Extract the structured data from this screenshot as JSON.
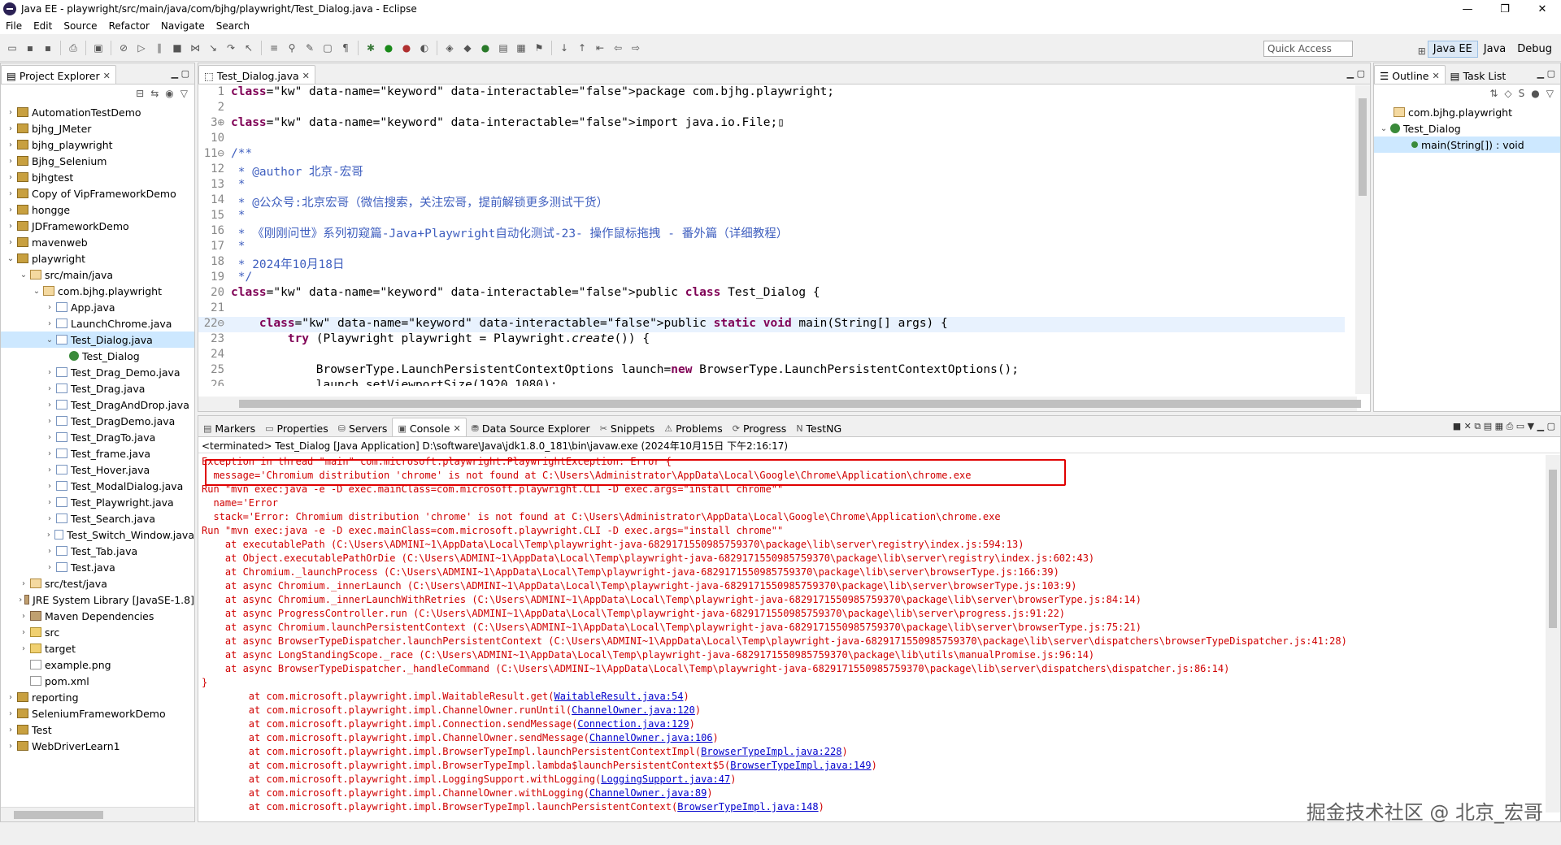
{
  "window": {
    "title": "Java EE - playwright/src/main/java/com/bjhg/playwright/Test_Dialog.java - Eclipse",
    "minimize": "—",
    "maximize": "❐",
    "close": "✕"
  },
  "menu": [
    "File",
    "Edit",
    "Source",
    "Refactor",
    "Navigate",
    "Search"
  ],
  "quick_access": {
    "placeholder": "Quick Access"
  },
  "perspectives": [
    "Java EE",
    "Java",
    "Debug"
  ],
  "project_explorer": {
    "tab": "Project Explorer",
    "items": [
      {
        "label": "AutomationTestDemo",
        "depth": 0,
        "icon": "project-icon"
      },
      {
        "label": "bjhg_JMeter",
        "depth": 0,
        "icon": "project-icon"
      },
      {
        "label": "bjhg_playwright",
        "depth": 0,
        "icon": "project-icon"
      },
      {
        "label": "Bjhg_Selenium",
        "depth": 0,
        "icon": "project-icon"
      },
      {
        "label": "bjhgtest",
        "depth": 0,
        "icon": "project-icon"
      },
      {
        "label": "Copy of VipFrameworkDemo",
        "depth": 0,
        "icon": "project-icon"
      },
      {
        "label": "hongge",
        "depth": 0,
        "icon": "project-icon"
      },
      {
        "label": "JDFrameworkDemo",
        "depth": 0,
        "icon": "project-icon"
      },
      {
        "label": "mavenweb",
        "depth": 0,
        "icon": "project-icon"
      },
      {
        "label": "playwright",
        "depth": 0,
        "icon": "project-icon"
      },
      {
        "label": "src/main/java",
        "depth": 1,
        "icon": "package-folder-icon"
      },
      {
        "label": "com.bjhg.playwright",
        "depth": 2,
        "icon": "package-icon"
      },
      {
        "label": "App.java",
        "depth": 3,
        "icon": "java-file-icon"
      },
      {
        "label": "LaunchChrome.java",
        "depth": 3,
        "icon": "java-file-icon"
      },
      {
        "label": "Test_Dialog.java",
        "depth": 3,
        "icon": "java-file-icon"
      },
      {
        "label": "Test_Dialog",
        "depth": 4,
        "icon": "class-icon"
      },
      {
        "label": "Test_Drag_Demo.java",
        "depth": 3,
        "icon": "java-file-icon"
      },
      {
        "label": "Test_Drag.java",
        "depth": 3,
        "icon": "java-file-icon"
      },
      {
        "label": "Test_DragAndDrop.java",
        "depth": 3,
        "icon": "java-file-icon"
      },
      {
        "label": "Test_DragDemo.java",
        "depth": 3,
        "icon": "java-file-icon"
      },
      {
        "label": "Test_DragTo.java",
        "depth": 3,
        "icon": "java-file-icon"
      },
      {
        "label": "Test_frame.java",
        "depth": 3,
        "icon": "java-file-icon"
      },
      {
        "label": "Test_Hover.java",
        "depth": 3,
        "icon": "java-file-icon"
      },
      {
        "label": "Test_ModalDialog.java",
        "depth": 3,
        "icon": "java-file-icon"
      },
      {
        "label": "Test_Playwright.java",
        "depth": 3,
        "icon": "java-file-icon"
      },
      {
        "label": "Test_Search.java",
        "depth": 3,
        "icon": "java-file-icon"
      },
      {
        "label": "Test_Switch_Window.java",
        "depth": 3,
        "icon": "java-file-icon"
      },
      {
        "label": "Test_Tab.java",
        "depth": 3,
        "icon": "java-file-icon"
      },
      {
        "label": "Test.java",
        "depth": 3,
        "icon": "java-file-icon"
      },
      {
        "label": "src/test/java",
        "depth": 1,
        "icon": "package-folder-icon"
      },
      {
        "label": "JRE System Library [JavaSE-1.8]",
        "depth": 1,
        "icon": "library-icon"
      },
      {
        "label": "Maven Dependencies",
        "depth": 1,
        "icon": "library-icon"
      },
      {
        "label": "src",
        "depth": 1,
        "icon": "folder-icon"
      },
      {
        "label": "target",
        "depth": 1,
        "icon": "folder-icon"
      },
      {
        "label": "example.png",
        "depth": 1,
        "icon": "file-icon"
      },
      {
        "label": "pom.xml",
        "depth": 1,
        "icon": "file-icon"
      },
      {
        "label": "reporting",
        "depth": 0,
        "icon": "project-icon"
      },
      {
        "label": "SeleniumFrameworkDemo",
        "depth": 0,
        "icon": "project-icon"
      },
      {
        "label": "Test",
        "depth": 0,
        "icon": "project-icon"
      },
      {
        "label": "WebDriverLearn1",
        "depth": 0,
        "icon": "project-icon"
      }
    ]
  },
  "editor": {
    "tab": "Test_Dialog.java",
    "lines": [
      {
        "n": "1",
        "text": "package com.bjhg.playwright;"
      },
      {
        "n": "2",
        "text": ""
      },
      {
        "n": "3⊕",
        "text": "import java.io.File;▯"
      },
      {
        "n": "10",
        "text": ""
      },
      {
        "n": "11⊖",
        "text": "/**"
      },
      {
        "n": "12",
        "text": " * @author 北京-宏哥"
      },
      {
        "n": "13",
        "text": " *"
      },
      {
        "n": "14",
        "text": " * @公众号:北京宏哥（微信搜索，关注宏哥，提前解锁更多测试干货）"
      },
      {
        "n": "15",
        "text": " *"
      },
      {
        "n": "16",
        "text": " * 《刚刚问世》系列初窥篇-Java+Playwright自动化测试-23- 操作鼠标拖拽 - 番外篇（详细教程）"
      },
      {
        "n": "17",
        "text": " *"
      },
      {
        "n": "18",
        "text": " * 2024年10月18日"
      },
      {
        "n": "19",
        "text": " */"
      },
      {
        "n": "20",
        "text": "public class Test_Dialog {"
      },
      {
        "n": "21",
        "text": ""
      },
      {
        "n": "22⊖",
        "text": "    public static void main(String[] args) {"
      },
      {
        "n": "23",
        "text": "        try (Playwright playwright = Playwright.create()) {"
      },
      {
        "n": "24",
        "text": ""
      },
      {
        "n": "25",
        "text": "            BrowserType.LaunchPersistentContextOptions launch=new BrowserType.LaunchPersistentContextOptions();"
      },
      {
        "n": "26",
        "text": "            launch.setViewportSize(1920,1080);"
      }
    ]
  },
  "outline": {
    "tabs": [
      "Outline",
      "Task List"
    ],
    "items": [
      {
        "label": "com.bjhg.playwright",
        "depth": 0
      },
      {
        "label": "Test_Dialog",
        "depth": 0
      },
      {
        "label": "main(String[]) : void",
        "depth": 1
      }
    ]
  },
  "bottom_tabs": [
    "Markers",
    "Properties",
    "Servers",
    "Console",
    "Data Source Explorer",
    "Snippets",
    "Problems",
    "Progress",
    "TestNG"
  ],
  "console": {
    "header": "<terminated> Test_Dialog [Java Application] D:\\software\\Java\\jdk1.8.0_181\\bin\\javaw.exe (2024年10月15日 下午2:16:17)",
    "lines": [
      "Exception in thread \"main\" com.microsoft.playwright.PlaywrightException: Error {",
      "  message='Chromium distribution 'chrome' is not found at C:\\Users\\Administrator\\AppData\\Local\\Google\\Chrome\\Application\\chrome.exe",
      "Run \"mvn exec:java -e -D exec.mainClass=com.microsoft.playwright.CLI -D exec.args=\"install chrome\"\"",
      "  name='Error",
      "  stack='Error: Chromium distribution 'chrome' is not found at C:\\Users\\Administrator\\AppData\\Local\\Google\\Chrome\\Application\\chrome.exe",
      "Run \"mvn exec:java -e -D exec.mainClass=com.microsoft.playwright.CLI -D exec.args=\"install chrome\"\"",
      "    at executablePath (C:\\Users\\ADMINI~1\\AppData\\Local\\Temp\\playwright-java-6829171550985759370\\package\\lib\\server\\registry\\index.js:594:13)",
      "    at Object.executablePathOrDie (C:\\Users\\ADMINI~1\\AppData\\Local\\Temp\\playwright-java-6829171550985759370\\package\\lib\\server\\registry\\index.js:602:43)",
      "    at Chromium._launchProcess (C:\\Users\\ADMINI~1\\AppData\\Local\\Temp\\playwright-java-6829171550985759370\\package\\lib\\server\\browserType.js:166:39)",
      "    at async Chromium._innerLaunch (C:\\Users\\ADMINI~1\\AppData\\Local\\Temp\\playwright-java-6829171550985759370\\package\\lib\\server\\browserType.js:103:9)",
      "    at async Chromium._innerLaunchWithRetries (C:\\Users\\ADMINI~1\\AppData\\Local\\Temp\\playwright-java-6829171550985759370\\package\\lib\\server\\browserType.js:84:14)",
      "    at async ProgressController.run (C:\\Users\\ADMINI~1\\AppData\\Local\\Temp\\playwright-java-6829171550985759370\\package\\lib\\server\\progress.js:91:22)",
      "    at async Chromium.launchPersistentContext (C:\\Users\\ADMINI~1\\AppData\\Local\\Temp\\playwright-java-6829171550985759370\\package\\lib\\server\\browserType.js:75:21)",
      "    at async BrowserTypeDispatcher.launchPersistentContext (C:\\Users\\ADMINI~1\\AppData\\Local\\Temp\\playwright-java-6829171550985759370\\package\\lib\\server\\dispatchers\\browserTypeDispatcher.js:41:28)",
      "    at async LongStandingScope._race (C:\\Users\\ADMINI~1\\AppData\\Local\\Temp\\playwright-java-6829171550985759370\\package\\lib\\utils\\manualPromise.js:96:14)",
      "    at async BrowserTypeDispatcher._handleCommand (C:\\Users\\ADMINI~1\\AppData\\Local\\Temp\\playwright-java-6829171550985759370\\package\\lib\\server\\dispatchers\\dispatcher.js:86:14)",
      "}"
    ],
    "stack": [
      {
        "text": "        at com.microsoft.playwright.impl.WaitableResult.get(",
        "link": "WaitableResult.java:54",
        "end": ")"
      },
      {
        "text": "        at com.microsoft.playwright.impl.ChannelOwner.runUntil(",
        "link": "ChannelOwner.java:120",
        "end": ")"
      },
      {
        "text": "        at com.microsoft.playwright.impl.Connection.sendMessage(",
        "link": "Connection.java:129",
        "end": ")"
      },
      {
        "text": "        at com.microsoft.playwright.impl.ChannelOwner.sendMessage(",
        "link": "ChannelOwner.java:106",
        "end": ")"
      },
      {
        "text": "        at com.microsoft.playwright.impl.BrowserTypeImpl.launchPersistentContextImpl(",
        "link": "BrowserTypeImpl.java:228",
        "end": ")"
      },
      {
        "text": "        at com.microsoft.playwright.impl.BrowserTypeImpl.lambda$launchPersistentContext$5(",
        "link": "BrowserTypeImpl.java:149",
        "end": ")"
      },
      {
        "text": "        at com.microsoft.playwright.impl.LoggingSupport.withLogging(",
        "link": "LoggingSupport.java:47",
        "end": ")"
      },
      {
        "text": "        at com.microsoft.playwright.impl.ChannelOwner.withLogging(",
        "link": "ChannelOwner.java:89",
        "end": ")"
      },
      {
        "text": "        at com.microsoft.playwright.impl.BrowserTypeImpl.launchPersistentContext(",
        "link": "BrowserTypeImpl.java:148",
        "end": ")"
      }
    ]
  },
  "watermark": "掘金技术社区 @ 北京_宏哥",
  "colors": {
    "error_text": "#d00000",
    "highlight_box": "#e00000",
    "link": "#0000cc",
    "keyword": "#7f0055",
    "comment": "#3f5fbf"
  }
}
